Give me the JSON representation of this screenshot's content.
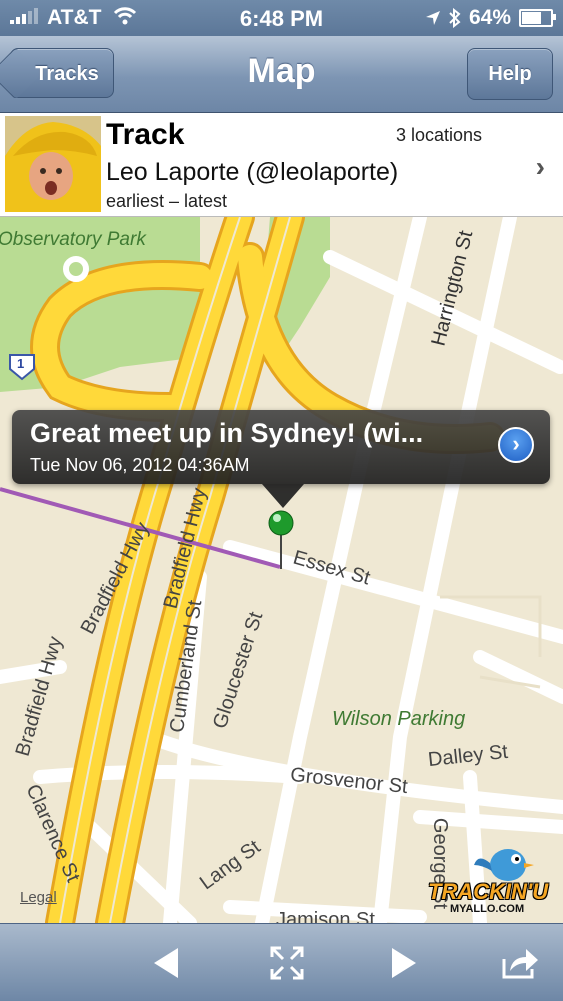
{
  "status_bar": {
    "carrier": "AT&T",
    "time": "6:48 PM",
    "battery": "64%",
    "battery_level": 0.64
  },
  "nav": {
    "back_label": "Tracks",
    "title": "Map",
    "help_label": "Help"
  },
  "track": {
    "title": "Track",
    "location_count": "3 locations",
    "user": "Leo Laporte (@leolaporte)",
    "range": "earliest – latest"
  },
  "map": {
    "labels": {
      "park": "Observatory Park",
      "harrington": "Harrington St",
      "bradfield1": "Bradfield Hwy",
      "bradfield2": "Bradfield Hwy",
      "bradfield3": "Bradfield Hwy",
      "cumberland": "Cumberland St",
      "gloucester": "Gloucester St",
      "essex": "Essex St",
      "wilson": "Wilson Parking",
      "dalley": "Dalley St",
      "grosvenor": "Grosvenor St",
      "clarence": "Clarence St",
      "lang": "Lang St",
      "george": "George St",
      "jamison": "Jamison St",
      "route": "1"
    },
    "callout": {
      "title": "Great meet up in Sydney! (wi...",
      "subtitle": "Tue Nov 06, 2012 04:36AM"
    },
    "legal": "Legal",
    "brand": {
      "name": "TRACKIN'U",
      "site": "MYALLO.COM"
    }
  },
  "toolbar": {
    "icons": [
      "previous-icon",
      "fit-map-icon",
      "next-icon",
      "share-icon"
    ]
  }
}
